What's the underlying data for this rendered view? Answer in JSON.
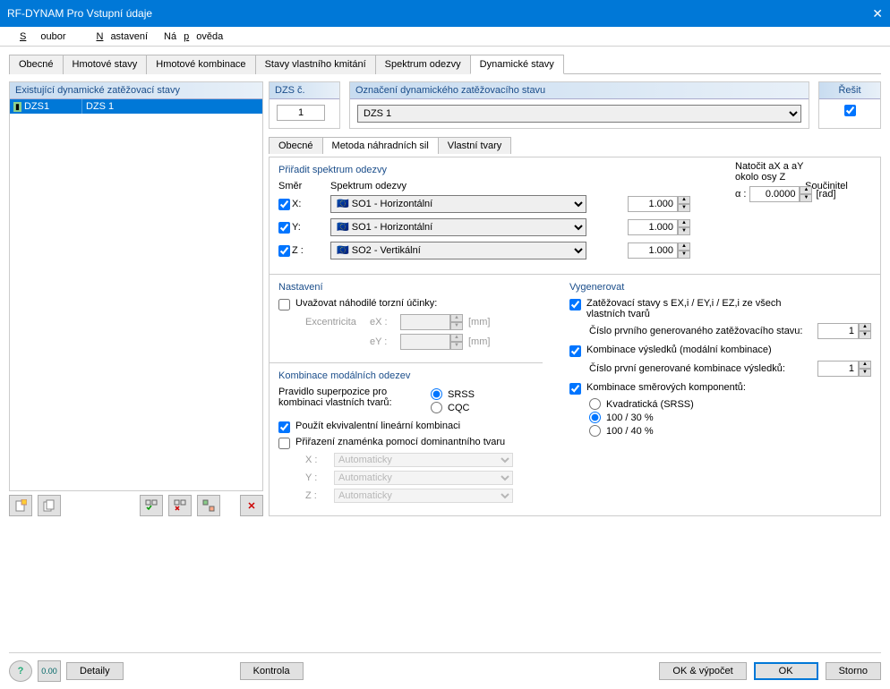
{
  "window": {
    "title": "RF-DYNAM Pro Vstupní údaje",
    "close": "✕"
  },
  "menu": {
    "file": "Soubor",
    "settings": "Nastavení",
    "help": "Nápověda"
  },
  "tabs": [
    "Obecné",
    "Hmotové stavy",
    "Hmotové kombinace",
    "Stavy vlastního kmitání",
    "Spektrum odezvy",
    "Dynamické stavy"
  ],
  "left": {
    "header": "Existující dynamické zatěžovací stavy",
    "row": {
      "id": "DZS1",
      "name": "DZS 1"
    }
  },
  "top": {
    "dzs_label": "DZS č.",
    "dzs_value": "1",
    "name_label": "Označení dynamického zatěžovacího stavu",
    "name_value": "DZS 1",
    "solve_label": "Řešit"
  },
  "subtabs": [
    "Obecné",
    "Metoda náhradních sil",
    "Vlastní tvary"
  ],
  "spectrum": {
    "group": "Přiřadit spektrum odezvy",
    "dir": "Směr",
    "spec": "Spektrum odezvy",
    "coef": "Součinitel",
    "rotate1": "Natočit aX a aY",
    "rotate2": "okolo osy Z",
    "alpha": "α :",
    "alpha_val": "0.0000",
    "rad": "[rad]",
    "x": "X:",
    "y": "Y:",
    "z": "Z :",
    "opt1": "SO1 - Horizontální",
    "opt2": "SO2 - Vertikální",
    "c1": "1.000",
    "c2": "1.000",
    "c3": "1.000"
  },
  "settings": {
    "title": "Nastavení",
    "torsion": "Uvažovat náhodilé torzní účinky:",
    "exc": "Excentricita",
    "ex": "eX :",
    "ey": "eY :",
    "mm": "[mm]"
  },
  "modal": {
    "title": "Kombinace modálních odezev",
    "rule": "Pravidlo superpozice pro kombinaci vlastních tvarů:",
    "srss": "SRSS",
    "cqc": "CQC",
    "eqlin": "Použít ekvivalentní lineární kombinaci",
    "sign": "Přiřazení znaménka pomocí dominantního tvaru",
    "x": "X :",
    "y": "Y :",
    "z": "Z :",
    "auto": "Automaticky"
  },
  "gen": {
    "title": "Vygenerovat",
    "chk1a": "Zatěžovací stavy s EX,i / EY,i  / EZ,i ze všech",
    "chk1b": "vlastních tvarů",
    "num1": "Číslo prvního generovaného zatěžovacího stavu:",
    "val1": "1",
    "chk2": "Kombinace výsledků (modální kombinace)",
    "num2": "Číslo první generované kombinace výsledků:",
    "val2": "1",
    "chk3": "Kombinace směrových komponentů:",
    "r1": "Kvadratická (SRSS)",
    "r2": "100 / 30 %",
    "r3": "100 / 40 %"
  },
  "footer": {
    "details": "Detaily",
    "kontrola": "Kontrola",
    "okcalc": "OK & výpočet",
    "ok": "OK",
    "storno": "Storno"
  }
}
